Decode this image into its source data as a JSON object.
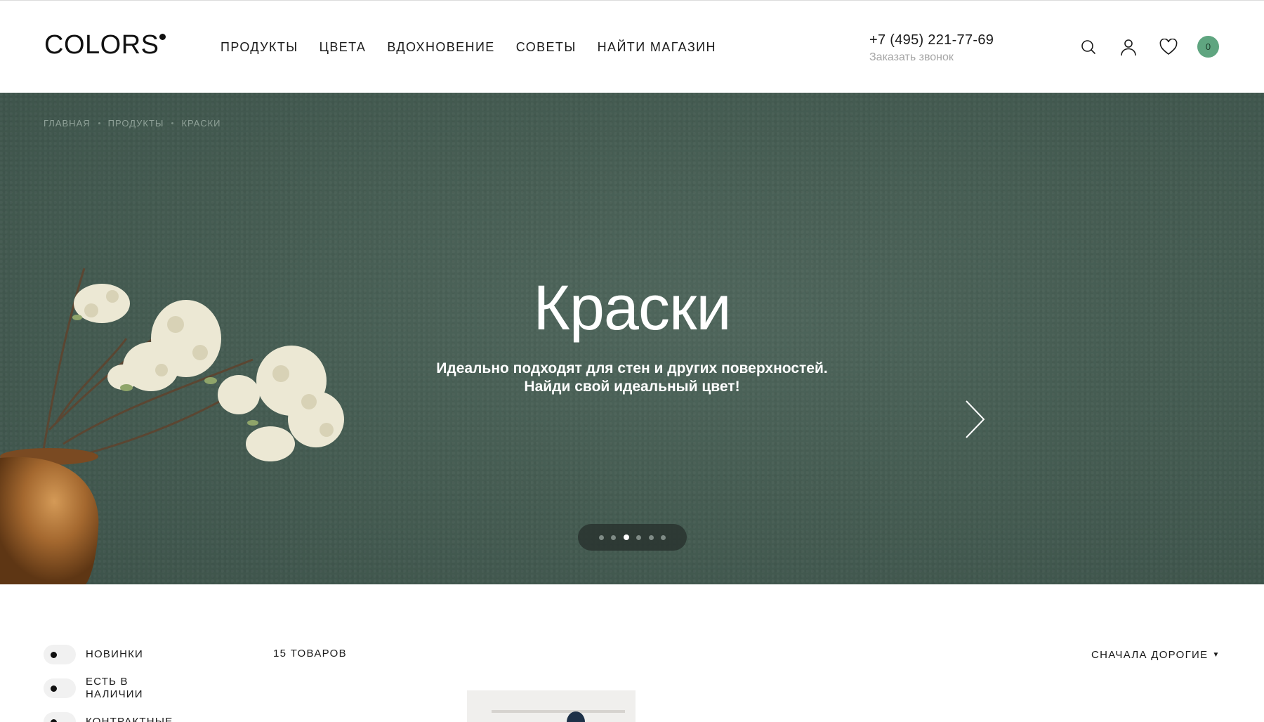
{
  "header": {
    "logo": "COLORS",
    "nav": [
      "ПРОДУКТЫ",
      "ЦВЕТА",
      "ВДОХНОВЕНИЕ",
      "СОВЕТЫ",
      "НАЙТИ МАГАЗИН"
    ],
    "phone": "+7 (495) 221-77-69",
    "callback": "Заказать звонок",
    "icons": [
      "search-icon",
      "user-icon",
      "heart-icon"
    ],
    "cart_count": "0",
    "cart_color": "#5fa580"
  },
  "hero": {
    "breadcrumb": [
      "ГЛАВНАЯ",
      "ПРОДУКТЫ",
      "КРАСКИ"
    ],
    "title": "Краски",
    "subtitle_line1": "Идеально подходят для стен и других поверхностей.",
    "subtitle_line2": "Найди свой идеальный цвет!",
    "slides_total": 6,
    "active_slide": 3,
    "background_color": "#465d53"
  },
  "catalog": {
    "filters": [
      {
        "label": "НОВИНКИ"
      },
      {
        "label": "ЕСТЬ В НАЛИЧИИ"
      },
      {
        "label": "КОНТРАКТНЫЕ"
      }
    ],
    "count_label": "15 ТОВАРОВ",
    "sort_label": "СНАЧАЛА ДОРОГИЕ"
  }
}
